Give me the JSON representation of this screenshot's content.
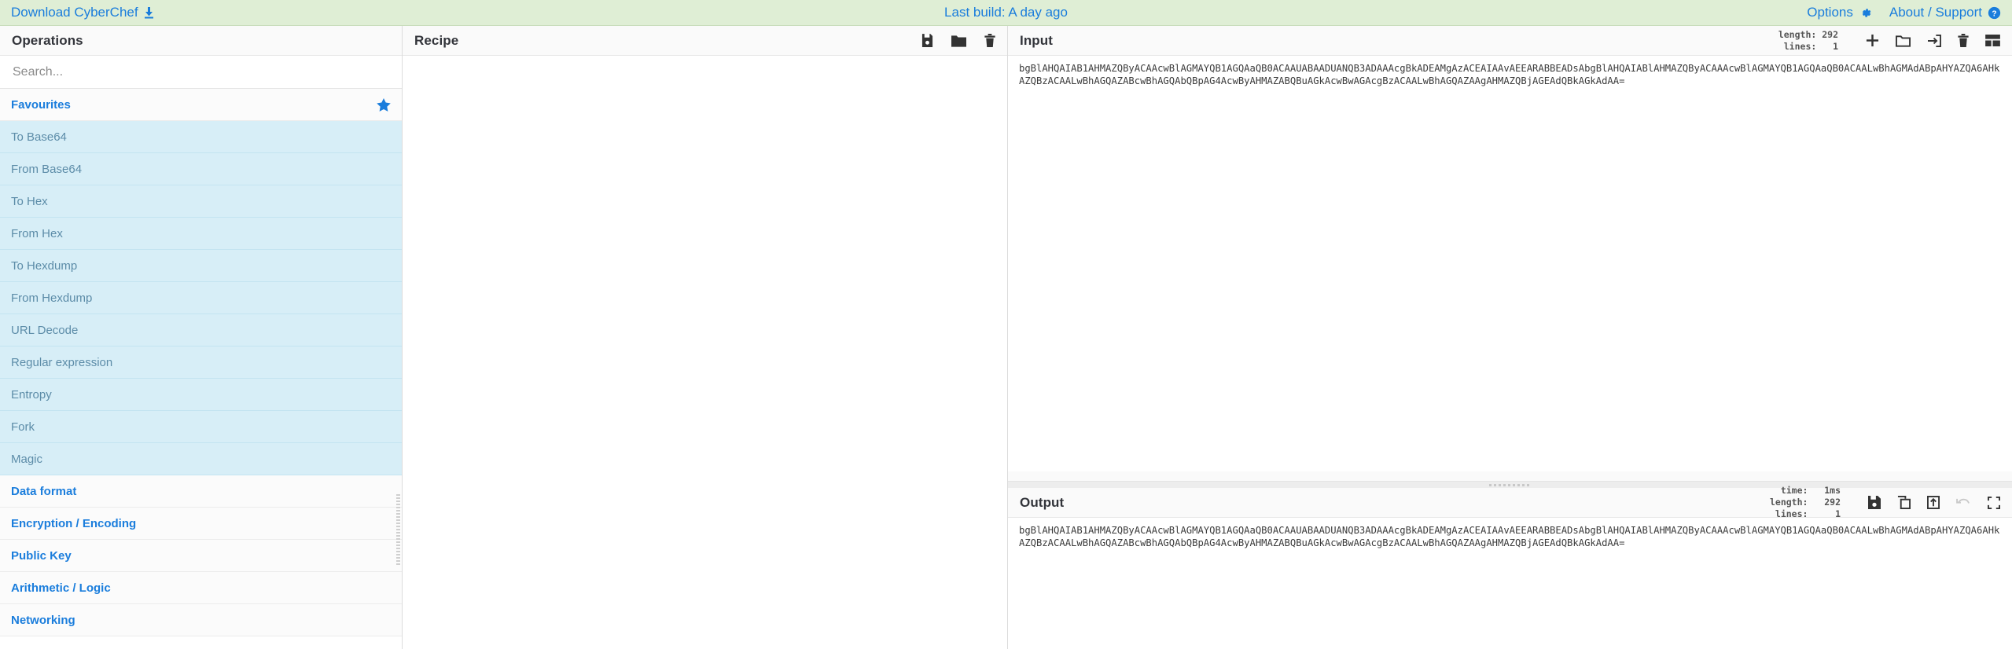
{
  "banner": {
    "download_label": "Download CyberChef",
    "download_icon": "download-icon",
    "last_build": "Last build: A day ago",
    "options_label": "Options",
    "options_icon": "gear-icon",
    "about_label": "About / Support",
    "about_icon": "question-circle-icon",
    "bg_color": "#dfeed5",
    "link_color": "#1a7ddc"
  },
  "operations": {
    "title": "Operations",
    "search": {
      "value": "",
      "placeholder": "Search...",
      "icon": "search-input"
    },
    "favourites": {
      "label": "Favourites",
      "icon": "star-icon"
    },
    "items": [
      {
        "label": "To Base64"
      },
      {
        "label": "From Base64"
      },
      {
        "label": "To Hex"
      },
      {
        "label": "From Hex"
      },
      {
        "label": "To Hexdump"
      },
      {
        "label": "From Hexdump"
      },
      {
        "label": "URL Decode"
      },
      {
        "label": "Regular expression"
      },
      {
        "label": "Entropy"
      },
      {
        "label": "Fork"
      },
      {
        "label": "Magic"
      }
    ],
    "categories": [
      {
        "label": "Data format"
      },
      {
        "label": "Encryption / Encoding"
      },
      {
        "label": "Public Key"
      },
      {
        "label": "Arithmetic / Logic"
      },
      {
        "label": "Networking"
      }
    ]
  },
  "recipe": {
    "title": "Recipe",
    "controls": [
      {
        "name": "save-recipe-button",
        "icon": "save-icon"
      },
      {
        "name": "load-recipe-button",
        "icon": "folder-icon"
      },
      {
        "name": "clear-recipe-button",
        "icon": "trash-icon"
      }
    ],
    "steps": []
  },
  "input": {
    "title": "Input",
    "meta": "length: 292\n lines:   1",
    "length_label": "length:",
    "length_value": "292",
    "lines_label": "lines:",
    "lines_value": "1",
    "value": "bgBlAHQAIAB1AHMAZQByACAAcwBlAGMAYQB1AGQAaQB0ACAAUABAADUANQB3ADAAAcgBkADEAMgAzACEAIAAvAEEARABBEADsAbgBlAHQAIABlAHMAZQByACAAAcwBlAGMAYQB1AGQAaQB0ACAALwBhAGMAdABpAHYAZQA6AHkAZQBzACAALwBhAGQAZABcwBhAGQAbQBpAG4AcwByAHMAZABQBuAGkAcwBwAGAcgBzACAALwBhAGQAZAAgAHMAZQBjAGEAdQBkAGkAdAA=",
    "controls": [
      {
        "name": "add-input-tab-button",
        "icon": "plus-icon"
      },
      {
        "name": "open-folder-button",
        "icon": "folder-outline-icon"
      },
      {
        "name": "open-file-as-input-button",
        "icon": "import-arrow-icon"
      },
      {
        "name": "clear-input-button",
        "icon": "trash-icon"
      },
      {
        "name": "reset-pane-layout-button",
        "icon": "layout-icon"
      }
    ]
  },
  "output": {
    "title": "Output",
    "time_label": "time:",
    "time_value": "1ms",
    "length_label": "length:",
    "length_value": "292",
    "lines_label": "lines:",
    "lines_value": "1",
    "meta": "  time:   1ms\nlength:   292\n lines:     1",
    "value": "bgBlAHQAIAB1AHMAZQByACAAcwBlAGMAYQB1AGQAaQB0ACAAUABAADUANQB3ADAAAcgBkADEAMgAzACEAIAAvAEEARABBEADsAbgBlAHQAIABlAHMAZQByACAAAcwBlAGMAYQB1AGQAaQB0ACAALwBhAGMAdABpAHYAZQA6AHkAZQBzACAALwBhAGQAZABcwBhAGQAbQBpAG4AcwByAHMAZABQBuAGkAcwBwAGAcgBzACAALwBhAGQAZAAgAHMAZQBjAGEAdQBkAGkAdAA=",
    "controls": [
      {
        "name": "save-output-button",
        "icon": "save-icon"
      },
      {
        "name": "copy-output-button",
        "icon": "copy-icon"
      },
      {
        "name": "replace-input-with-output-button",
        "icon": "export-arrow-icon"
      },
      {
        "name": "undo-button",
        "icon": "undo-icon",
        "disabled": true
      },
      {
        "name": "maximise-output-button",
        "icon": "maximise-icon"
      }
    ]
  }
}
